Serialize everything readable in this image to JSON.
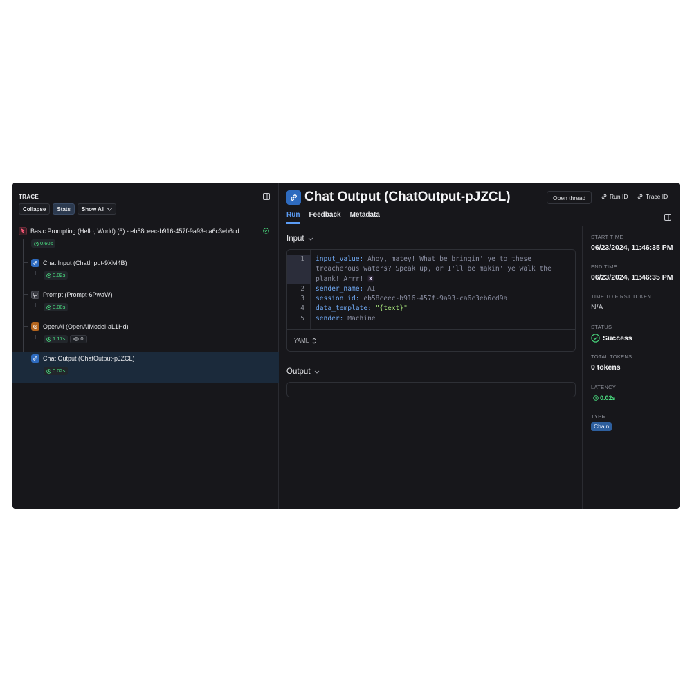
{
  "trace": {
    "title": "TRACE",
    "buttons": {
      "collapse": "Collapse",
      "stats": "Stats",
      "show_all": "Show All"
    },
    "nodes": [
      {
        "label": "Basic Prompting (Hello, World) (6) - eb58ceec-b916-457f-9a93-ca6c3eb6cd...",
        "latency": "0.60s",
        "icon": "root-app-icon"
      },
      {
        "label": "Chat Input (ChatInput-9XM4B)",
        "latency": "0.02s",
        "icon": "link-icon"
      },
      {
        "label": "Prompt (Prompt-6PwaW)",
        "latency": "0.00s",
        "icon": "prompt-icon"
      },
      {
        "label": "OpenAI (OpenAIModel-aL1Hd)",
        "latency": "1.17s",
        "tokens": "0",
        "icon": "openai-icon"
      },
      {
        "label": "Chat Output (ChatOutput-pJZCL)",
        "latency": "0.02s",
        "icon": "link-icon"
      }
    ]
  },
  "header": {
    "title": "Chat Output (ChatOutput-pJZCL)",
    "open_thread": "Open thread",
    "run_id": "Run ID",
    "trace_id": "Trace ID",
    "tabs": [
      "Run",
      "Feedback",
      "Metadata"
    ]
  },
  "input": {
    "title": "Input",
    "lines": [
      {
        "num": "1",
        "key": "input_value",
        "value": " Ahoy, matey! What be bringin' ye to these"
      },
      {
        "num": "",
        "key": "",
        "value": "treacherous waters? Speak up, or I'll be makin' ye walk the"
      },
      {
        "num": "",
        "key": "",
        "value": "plank! Arrr! "
      },
      {
        "num": "2",
        "key": "sender_name",
        "value": " AI"
      },
      {
        "num": "3",
        "key": "session_id",
        "value": " eb58ceec-b916-457f-9a93-ca6c3eb6cd9a"
      },
      {
        "num": "4",
        "key": "data_template",
        "value": " \"{text}\""
      },
      {
        "num": "5",
        "key": "sender",
        "value": " Machine"
      }
    ],
    "format": "YAML"
  },
  "output": {
    "title": "Output"
  },
  "meta": {
    "start_time_label": "START TIME",
    "start_time": "06/23/2024, 11:46:35 PM",
    "end_time_label": "END TIME",
    "end_time": "06/23/2024, 11:46:35 PM",
    "ttft_label": "TIME TO FIRST TOKEN",
    "ttft": "N/A",
    "status_label": "STATUS",
    "status": "Success",
    "total_tokens_label": "TOTAL TOKENS",
    "total_tokens": "0 tokens",
    "latency_label": "LATENCY",
    "latency": "0.02s",
    "type_label": "TYPE",
    "type": "Chain"
  },
  "colors": {
    "accent": "#5b9cf5",
    "success": "#4ade80",
    "chain_badge": "#2e5f9e",
    "background": "#17171b"
  }
}
